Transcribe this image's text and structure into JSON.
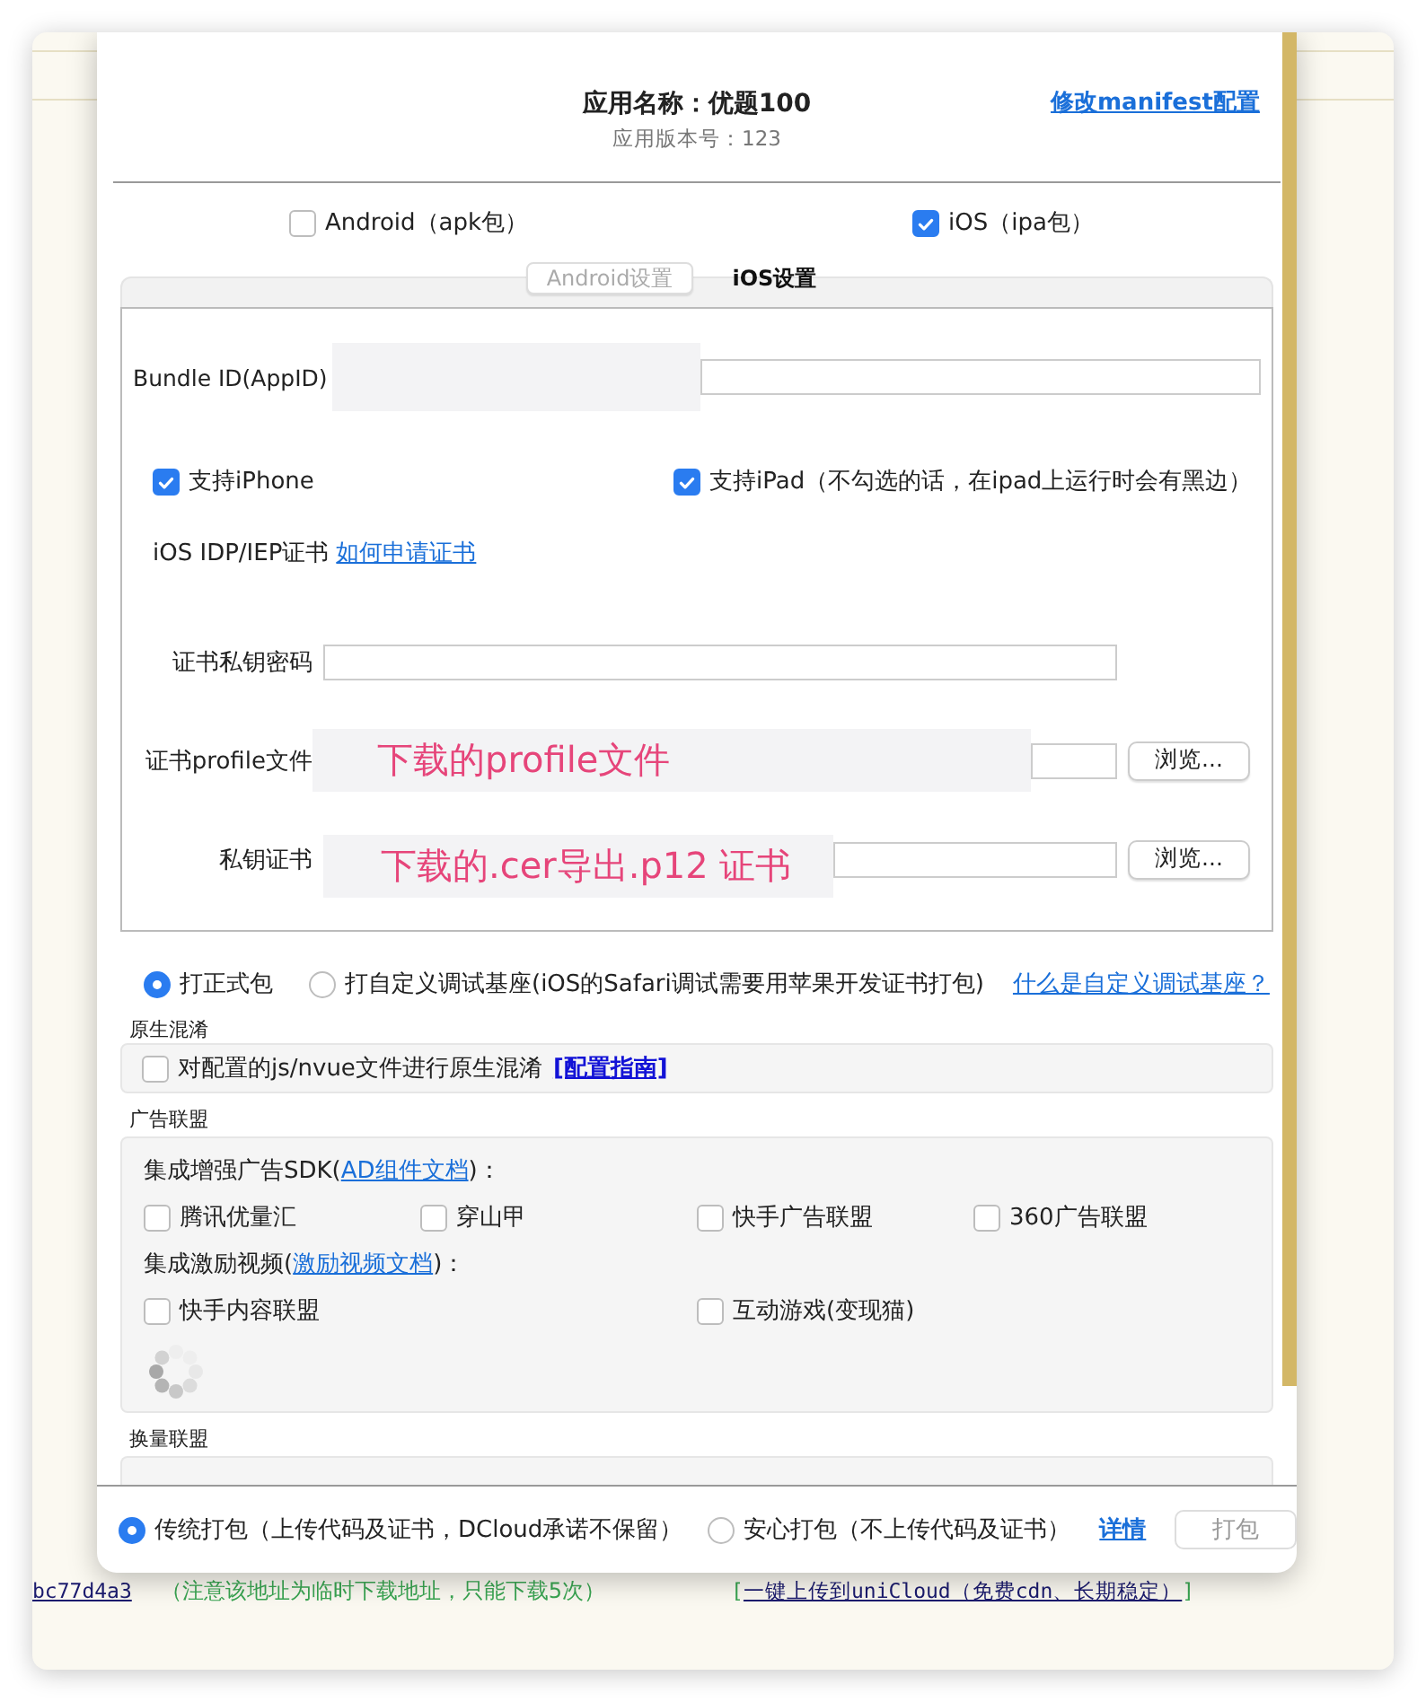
{
  "app": {
    "name_line": "应用名称：优题100",
    "version_line": "应用版本号：123",
    "manifest_link": "修改manifest配置"
  },
  "platforms": [
    {
      "label": "Android（apk包）",
      "checked": false
    },
    {
      "label": "iOS（ipa包）",
      "checked": true
    }
  ],
  "tabs": [
    {
      "label": "Android设置",
      "selected": false
    },
    {
      "label": "iOS设置",
      "selected": true
    }
  ],
  "ios": {
    "bundle_label": "Bundle ID(AppID)",
    "devices": [
      {
        "label": "支持iPhone",
        "checked": true
      },
      {
        "label": "支持iPad（不勾选的话，在ipad上运行时会有黑边）",
        "checked": true
      }
    ],
    "cert_label": "iOS IDP/IEP证书",
    "cert_link": "如何申请证书",
    "fields": [
      {
        "label": "证书私钥密码",
        "kind": "password"
      },
      {
        "label": "证书profile文件",
        "kind": "file",
        "button": "浏览...",
        "annotation": "下载的profile文件"
      },
      {
        "label": "私钥证书",
        "kind": "file",
        "button": "浏览...",
        "annotation": "下载的.cer导出.p12 证书"
      }
    ]
  },
  "build_types": [
    {
      "label": "打正式包",
      "selected": true
    },
    {
      "label": "打自定义调试基座(iOS的Safari调试需要用苹果开发证书打包)",
      "selected": false
    }
  ],
  "build_type_link": "什么是自定义调试基座？",
  "obfuscation": {
    "title": "原生混淆",
    "label": "对配置的js/nvue文件进行原生混淆",
    "checked": false,
    "link": "[配置指南]"
  },
  "ads": {
    "title": "广告联盟",
    "groups": [
      {
        "prefix": "集成增强广告SDK(",
        "link": "AD组件文档",
        "suffix": ")：",
        "options": [
          {
            "label": "腾讯优量汇",
            "checked": false
          },
          {
            "label": "穿山甲",
            "checked": false
          },
          {
            "label": "快手广告联盟",
            "checked": false
          },
          {
            "label": "360广告联盟",
            "checked": false
          }
        ]
      },
      {
        "prefix": "集成激励视频(",
        "link": "激励视频文档",
        "suffix": ")：",
        "options": [
          {
            "label": "快手内容联盟",
            "checked": false
          },
          {
            "label": "互动游戏(变现猫)",
            "checked": false
          }
        ]
      }
    ]
  },
  "exchange": {
    "title": "换量联盟"
  },
  "footer": {
    "modes": [
      {
        "label": "传统打包（上传代码及证书，DCloud承诺不保留）",
        "selected": true
      },
      {
        "label": "安心打包（不上传代码及证书）",
        "selected": false
      }
    ],
    "details_link": "详情",
    "pack_button": {
      "label": "打包",
      "disabled": true
    }
  },
  "background": {
    "url_tail": "bc77d4a3",
    "note": "（注意该地址为临时下载地址，只能下载5次）",
    "upload_open": "[",
    "upload_link": "一键上传到uniCloud（免费cdn、长期稳定）",
    "upload_close": "]"
  }
}
